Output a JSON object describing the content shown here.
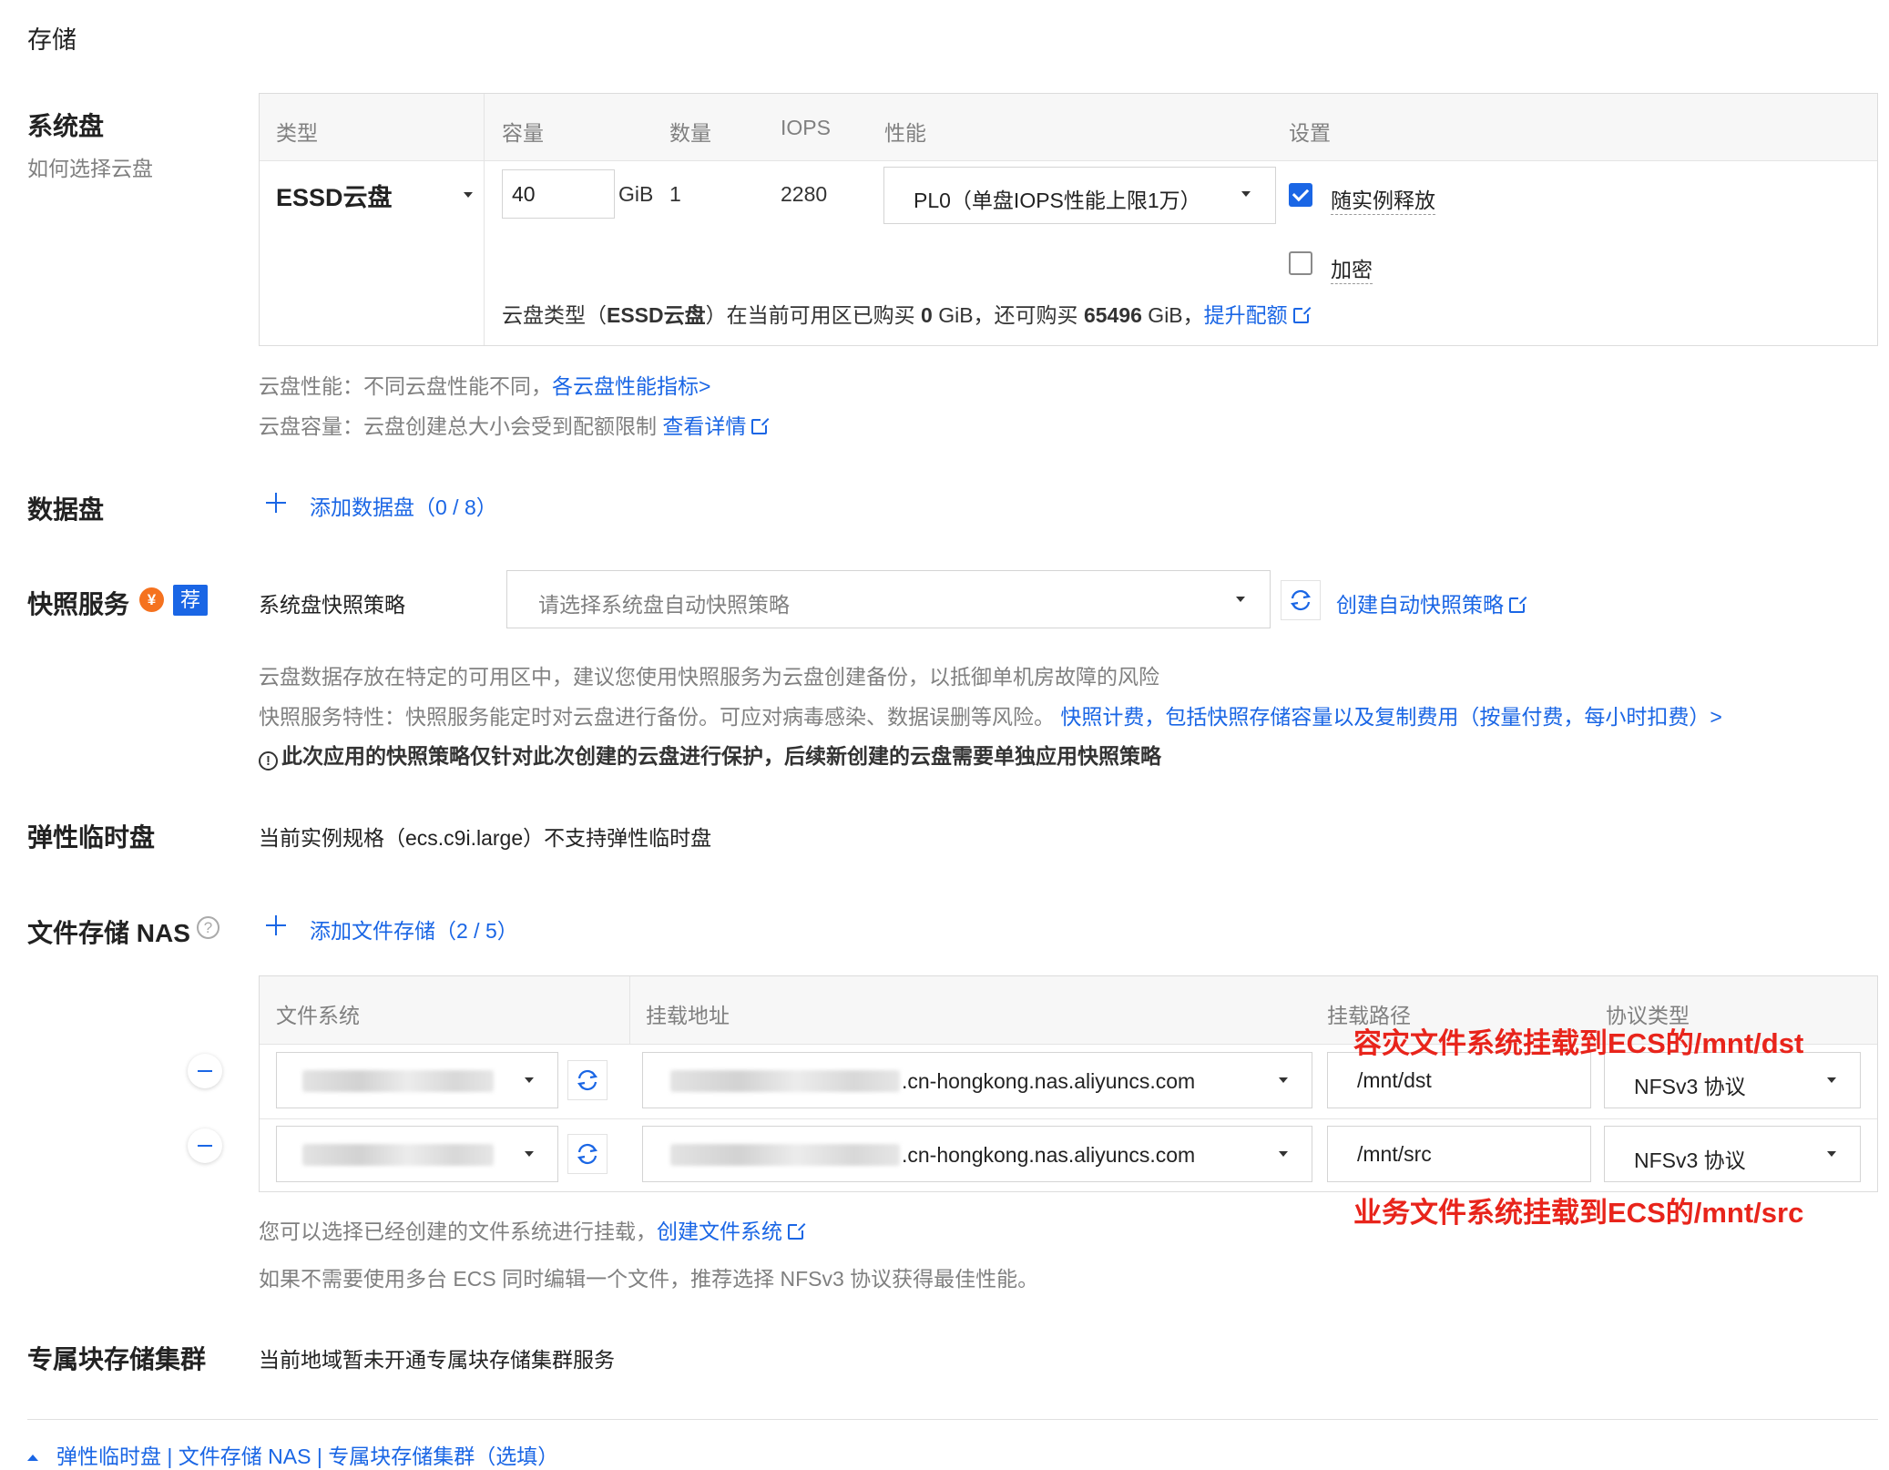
{
  "page": {
    "title": "存储"
  },
  "system_disk": {
    "label": "系统盘",
    "help_link": "如何选择云盘",
    "headers": {
      "type": "类型",
      "capacity": "容量",
      "quantity": "数量",
      "iops": "IOPS",
      "performance": "性能",
      "settings": "设置"
    },
    "type_value": "ESSD云盘",
    "capacity_value": "40",
    "capacity_unit": "GiB",
    "quantity_value": "1",
    "iops_value": "2280",
    "performance_value": "PL0（单盘IOPS性能上限1万）",
    "release_label": "随实例释放",
    "release_checked": true,
    "encrypt_label": "加密",
    "encrypt_checked": false,
    "quota_prefix": "云盘类型（",
    "quota_type": "ESSD云盘",
    "quota_mid1": "）在当前可用区已购买 ",
    "quota_bought": "0",
    "quota_mid2": " GiB，还可购买 ",
    "quota_remaining": "65496",
    "quota_mid3": " GiB，",
    "quota_link": "提升配额",
    "perf_note": "云盘性能：不同云盘性能不同，",
    "perf_link": "各云盘性能指标>",
    "cap_note": "云盘容量：云盘创建总大小会受到配额限制 ",
    "cap_link": "查看详情"
  },
  "data_disk": {
    "label": "数据盘",
    "add_label": "添加数据盘（0 / 8）"
  },
  "snapshot": {
    "label": "快照服务",
    "yen_badge": "¥",
    "recommend_badge": "荐",
    "policy_label": "系统盘快照策略",
    "policy_placeholder": "请选择系统盘自动快照策略",
    "create_link": "创建自动快照策略",
    "note1": "云盘数据存放在特定的可用区中，建议您使用快照服务为云盘创建备份，以抵御单机房故障的风险",
    "note2_prefix": "快照服务特性：快照服务能定时对云盘进行备份。可应对病毒感染、数据误删等风险。 ",
    "note2_link": "快照计费，包括快照存储容量以及复制费用（按量付费，每小时扣费）>",
    "warning": "此次应用的快照策略仅针对此次创建的云盘进行保护，后续新创建的云盘需要单独应用快照策略"
  },
  "elastic_temp": {
    "label": "弹性临时盘",
    "note": "当前实例规格（ecs.c9i.large）不支持弹性临时盘"
  },
  "nas": {
    "label": "文件存储 NAS",
    "add_label": "添加文件存储（2 / 5）",
    "headers": {
      "fs": "文件系统",
      "mount_addr": "挂载地址",
      "mount_path": "挂载路径",
      "protocol": "协议类型"
    },
    "rows": [
      {
        "addr_suffix": ".cn-hongkong.nas.aliyuncs.com",
        "path": "/mnt/dst",
        "protocol": "NFSv3 协议"
      },
      {
        "addr_suffix": ".cn-hongkong.nas.aliyuncs.com",
        "path": "/mnt/src",
        "protocol": "NFSv3 协议"
      }
    ],
    "annotation_dst": "容灾文件系统挂载到ECS的/mnt/dst",
    "annotation_src": "业务文件系统挂载到ECS的/mnt/src",
    "note1": "您可以选择已经创建的文件系统进行挂载，",
    "note1_link": "创建文件系统",
    "note2": "如果不需要使用多台 ECS 同时编辑一个文件，推荐选择 NFSv3 协议获得最佳性能。"
  },
  "dedicated": {
    "label": "专属块存储集群",
    "note": "当前地域暂未开通专属块存储集群服务"
  },
  "footer": {
    "collapse_link": "弹性临时盘 | 文件存储 NAS | 专属块存储集群（选填）"
  },
  "colors": {
    "accent": "#1a66e5",
    "annotation": "#e8241b",
    "badge_yen": "#f5721f"
  }
}
